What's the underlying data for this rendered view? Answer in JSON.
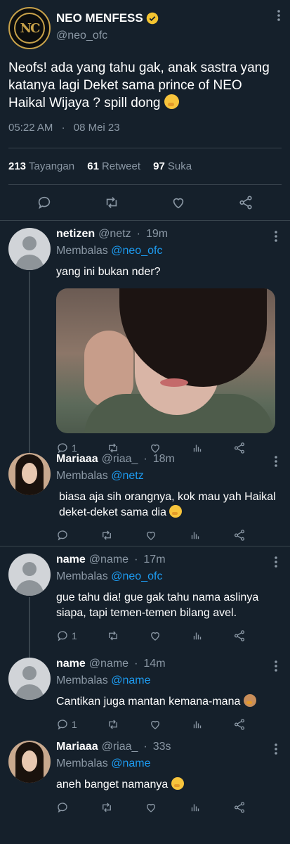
{
  "tweet": {
    "display_name": "NEO MENFESS",
    "handle": "@neo_ofc",
    "avatar_text": "NC",
    "text": "Neofs! ada yang tahu gak, anak sastra yang katanya lagi Deket sama prince of NEO Haikal Wijaya ? spill dong",
    "time": "05:22 AM",
    "dot": "·",
    "date": "08 Mei 23",
    "views_count": "213",
    "views_label": "Tayangan",
    "retweets_count": "61",
    "retweets_label": "Retweet",
    "likes_count": "97",
    "likes_label": "Suka"
  },
  "replying_label": "Membalas",
  "replies": [
    {
      "name": "netizen",
      "handle": "@netz",
      "dot": "·",
      "time": "19m",
      "reply_to": "@neo_ofc",
      "text": "yang ini bukan nder?",
      "reply_count": "1"
    },
    {
      "name": "Mariaaa",
      "handle": "@riaa_",
      "dot": "·",
      "time": "18m",
      "reply_to": "@netz",
      "text": "biasa aja sih orangnya, kok mau yah Haikal deket-deket sama dia",
      "reply_count": ""
    },
    {
      "name": "name",
      "handle": "@name",
      "dot": "·",
      "time": "17m",
      "reply_to": "@neo_ofc",
      "text": "gue tahu dia! gue gak tahu nama aslinya siapa, tapi temen-temen bilang avel.",
      "reply_count": "1"
    },
    {
      "name": "name",
      "handle": "@name",
      "dot": "·",
      "time": "14m",
      "reply_to": "@name",
      "text": "Cantikan juga mantan kemana-mana",
      "reply_count": "1"
    },
    {
      "name": "Mariaaa",
      "handle": "@riaa_",
      "dot": "·",
      "time": "33s",
      "reply_to": "@name",
      "text": "aneh banget namanya",
      "reply_count": ""
    }
  ],
  "colors": {
    "background": "#15202b",
    "link": "#1d9bf0",
    "muted": "#8b98a5",
    "divider": "#38444d",
    "verified": "#f4c430"
  }
}
